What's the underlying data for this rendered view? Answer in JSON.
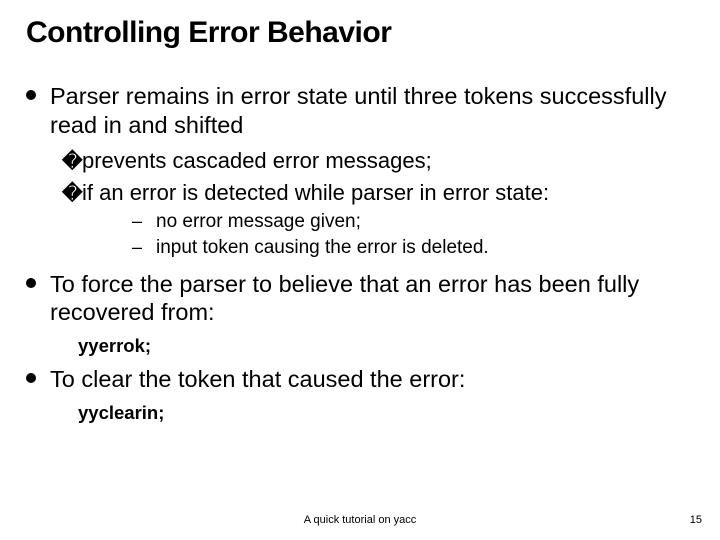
{
  "title": "Controlling Error Behavior",
  "items": [
    {
      "text": "Parser remains in error state until three tokens successfully read in and shifted",
      "sub": [
        {
          "text": "prevents cascaded error messages;"
        },
        {
          "text": "if an error is detected while parser in error state:",
          "sub": [
            {
              "text": "no error message given;"
            },
            {
              "text": "input token causing the error is deleted."
            }
          ]
        }
      ]
    },
    {
      "text": "To force the parser to believe that an error has been fully recovered from:",
      "code": "yyerrok;"
    },
    {
      "text": "To clear the token that caused the error:",
      "code": "yyclearin;"
    }
  ],
  "footer": {
    "center": "A quick tutorial on yacc",
    "page": "15"
  }
}
